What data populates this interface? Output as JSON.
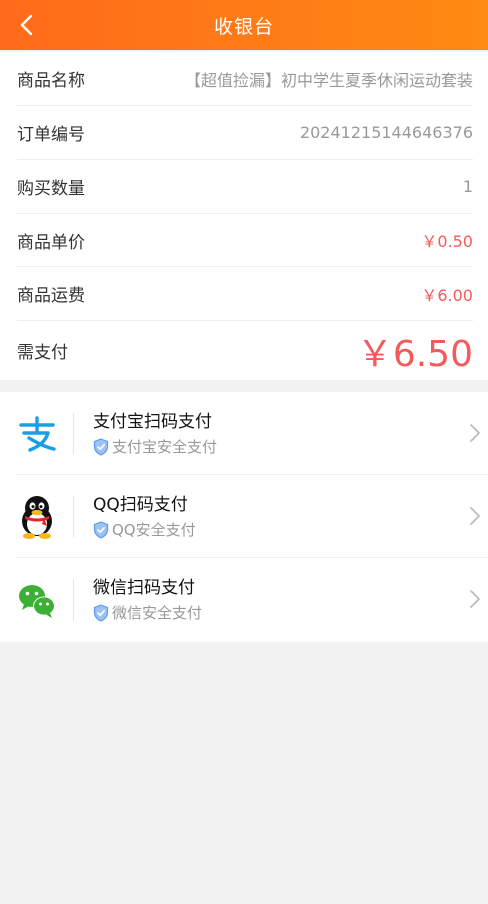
{
  "header": {
    "title": "收银台",
    "back_icon": "chevron-left-icon"
  },
  "order_info": {
    "rows": [
      {
        "label": "商品名称",
        "value": "【超值捡漏】初中学生夏季休闲运动套装"
      },
      {
        "label": "订单编号",
        "value": "20241215144646376"
      },
      {
        "label": "购买数量",
        "value": "1"
      },
      {
        "label": "商品单价",
        "value": "￥0.50"
      },
      {
        "label": "商品运费",
        "value": "￥6.00"
      },
      {
        "label": "需支付",
        "value": "￥6.50"
      }
    ]
  },
  "payment_methods": [
    {
      "title": "支付宝扫码支付",
      "subtitle": "支付宝安全支付",
      "icon": "alipay-icon"
    },
    {
      "title": "QQ扫码支付",
      "subtitle": "QQ安全支付",
      "icon": "qq-penguin-icon"
    },
    {
      "title": "微信扫码支付",
      "subtitle": "微信安全支付",
      "icon": "wechat-icon"
    }
  ],
  "colors": {
    "header_start": "#ff6a1a",
    "header_end": "#ff8a12",
    "price_red": "#f45a5a",
    "alipay_blue": "#1a9ee8",
    "wechat_green": "#3cb034",
    "shield_blue": "#5b9bea"
  }
}
